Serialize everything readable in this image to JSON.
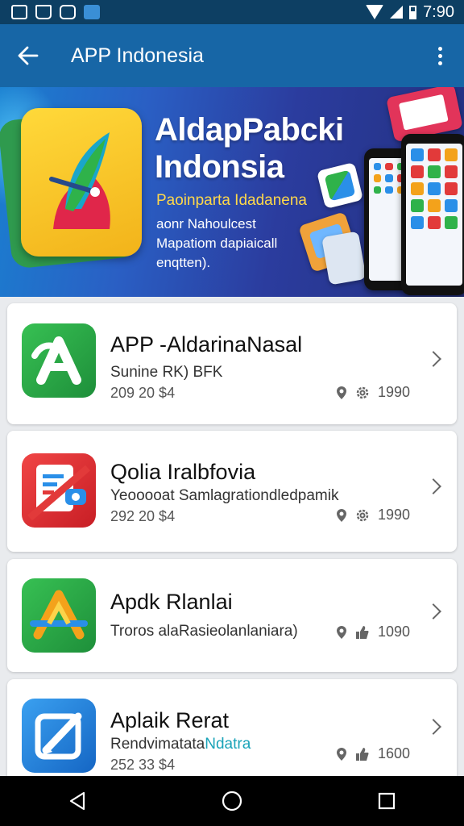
{
  "status_bar": {
    "time": "7:90",
    "icons": [
      "photo-icon",
      "bag-icon",
      "chat-icon",
      "note-icon",
      "wifi-icon",
      "signal-icon",
      "battery-icon"
    ]
  },
  "app_bar": {
    "title": "APP Indonesia",
    "back_icon": "arrow-left-icon",
    "menu_icon": "more-vert-icon"
  },
  "banner": {
    "headline": "AldapPabcki Indonsia",
    "subtitle": "Paoinparta Idadanena",
    "tagline": "aonr Nahoulcest Mapatiom dapiaicall enqtten)."
  },
  "apps": [
    {
      "name": "APP -AldarinaNasal",
      "description": "Sunine RK) BFK",
      "meta": "209 20 $4",
      "stat": "1990",
      "icon": "green-a-logo-icon",
      "colors": [
        "#2fb24a",
        "#1e8f3a"
      ]
    },
    {
      "name": "Qolia Iralbfovia",
      "description": "Yeooooat Samlagrationdledpamik",
      "meta": "292 20 $4",
      "stat": "1990",
      "icon": "red-document-icon",
      "colors": [
        "#e23a3a",
        "#c81e25"
      ]
    },
    {
      "name": "Apdk Rlanlai",
      "description": "Troros alaRasieolanlaniara)",
      "meta": "",
      "stat": "1090",
      "icon": "green-orange-triangle-icon",
      "colors": [
        "#2fb24a",
        "#f3a21b"
      ]
    },
    {
      "name": "Aplaik Rerat",
      "description": "Rendvimatata",
      "description_accent": "Ndatra",
      "meta": "252 33 $4",
      "stat": "1600",
      "icon": "blue-edit-icon",
      "colors": [
        "#2a8fe8",
        "#1566c4"
      ]
    }
  ],
  "nav": {
    "back_icon": "nav-back-icon",
    "home_icon": "nav-home-icon",
    "recents_icon": "nav-recents-icon"
  }
}
